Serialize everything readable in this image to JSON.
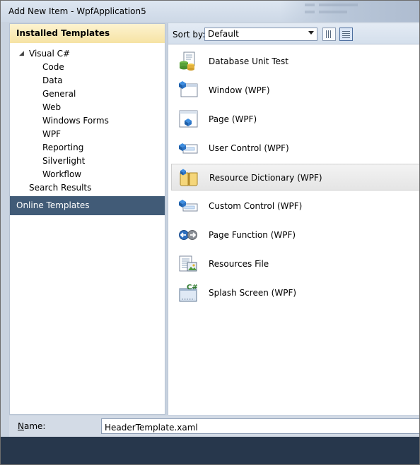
{
  "window": {
    "title": "Add New Item - WpfApplication5"
  },
  "left": {
    "installed_header": "Installed Templates",
    "tree": [
      {
        "label": "Visual C#",
        "expanded": true
      },
      {
        "label": "Code"
      },
      {
        "label": "Data"
      },
      {
        "label": "General"
      },
      {
        "label": "Web"
      },
      {
        "label": "Windows Forms"
      },
      {
        "label": "WPF"
      },
      {
        "label": "Reporting"
      },
      {
        "label": "Silverlight"
      },
      {
        "label": "Workflow"
      }
    ],
    "search_results": "Search Results",
    "online_header": "Online Templates"
  },
  "toolbar": {
    "sort_label": "Sort by:",
    "sort_value": "Default"
  },
  "templates": [
    {
      "label": "Database Unit Test",
      "icon": "database-unit-test-icon"
    },
    {
      "label": "Window (WPF)",
      "icon": "wpf-window-icon"
    },
    {
      "label": "Page (WPF)",
      "icon": "wpf-page-icon"
    },
    {
      "label": "User Control (WPF)",
      "icon": "user-control-icon"
    },
    {
      "label": "Resource Dictionary (WPF)",
      "icon": "resource-dictionary-icon",
      "selected": true
    },
    {
      "label": "Custom Control (WPF)",
      "icon": "custom-control-icon"
    },
    {
      "label": "Page Function (WPF)",
      "icon": "page-function-icon"
    },
    {
      "label": "Resources File",
      "icon": "resources-file-icon"
    },
    {
      "label": "Splash Screen (WPF)",
      "icon": "splash-screen-icon"
    }
  ],
  "name_field": {
    "label_underlined": "N",
    "label_rest": "ame:",
    "value": "HeaderTemplate.xaml"
  },
  "colors": {
    "installed_header_bg": "#f6e3a4",
    "online_header_bg": "#415b77",
    "footer_bg": "#27374c"
  }
}
